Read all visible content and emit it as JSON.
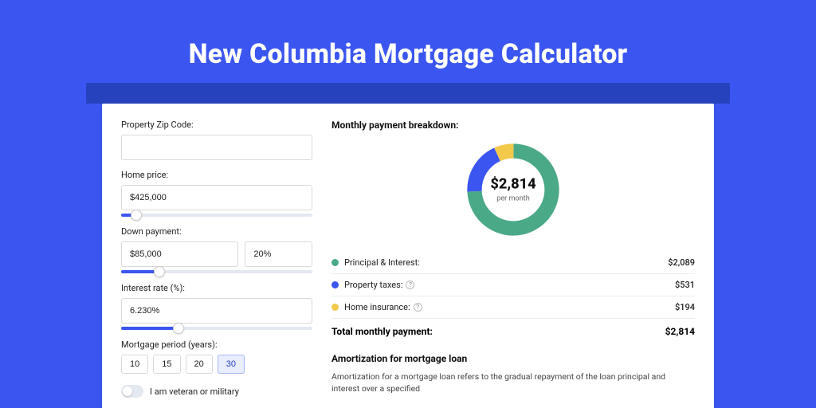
{
  "title": "New Columbia Mortgage Calculator",
  "colors": {
    "green": "#4aa986",
    "blue": "#3b56f0",
    "yellow": "#f3c94b"
  },
  "form": {
    "zip": {
      "label": "Property Zip Code:",
      "value": ""
    },
    "price": {
      "label": "Home price:",
      "value": "$425,000",
      "slider_pct": 8
    },
    "down": {
      "label": "Down payment:",
      "value": "$85,000",
      "pct": "20%",
      "slider_pct": 20
    },
    "rate": {
      "label": "Interest rate (%):",
      "value": "6.230%",
      "slider_pct": 30
    },
    "period": {
      "label": "Mortgage period (years):",
      "options": [
        "10",
        "15",
        "20",
        "30"
      ],
      "active": "30"
    },
    "veteran": {
      "label": "I am veteran or military",
      "checked": false
    }
  },
  "breakdown": {
    "heading": "Monthly payment breakdown:",
    "center_amount": "$2,814",
    "center_sub": "per month",
    "items": [
      {
        "label": "Principal & Interest:",
        "amount": "$2,089",
        "colorKey": "green",
        "info": false
      },
      {
        "label": "Property taxes:",
        "amount": "$531",
        "colorKey": "blue",
        "info": true
      },
      {
        "label": "Home insurance:",
        "amount": "$194",
        "colorKey": "yellow",
        "info": true
      }
    ],
    "total_label": "Total monthly payment:",
    "total_amount": "$2,814"
  },
  "chart_data": {
    "type": "pie",
    "title": "Monthly payment breakdown",
    "categories": [
      "Principal & Interest",
      "Property taxes",
      "Home insurance"
    ],
    "values": [
      2089,
      531,
      194
    ],
    "total": 2814
  },
  "amort": {
    "heading": "Amortization for mortgage loan",
    "text": "Amortization for a mortgage loan refers to the gradual repayment of the loan principal and interest over a specified"
  }
}
